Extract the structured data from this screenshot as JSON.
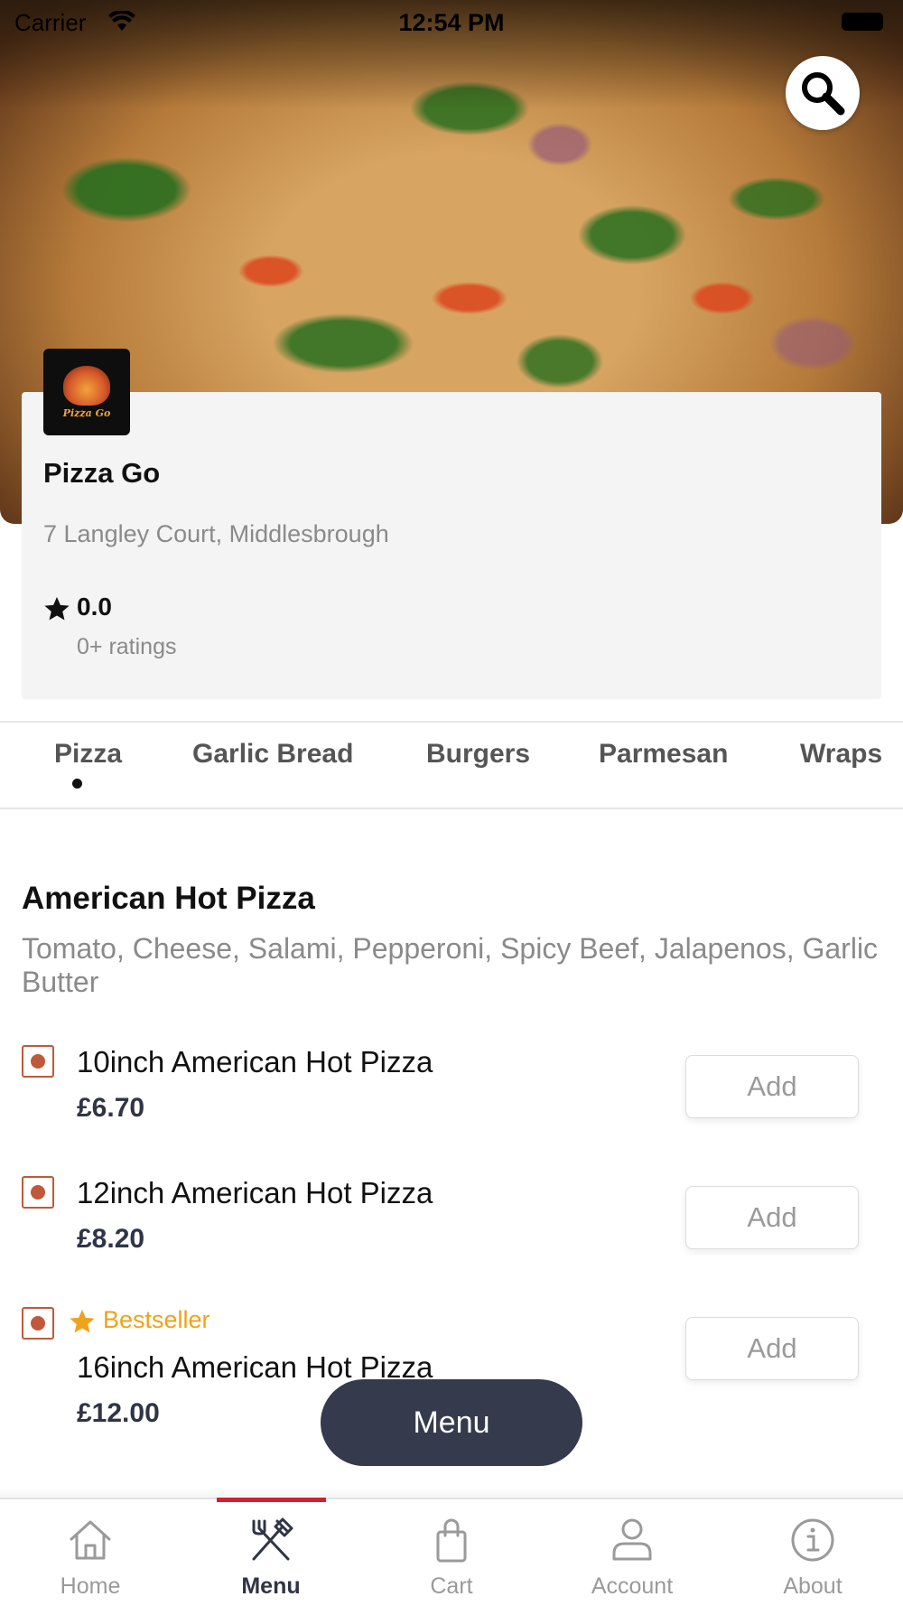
{
  "status_bar": {
    "carrier": "Carrier",
    "time": "12:54 PM"
  },
  "restaurant": {
    "logo_text": "Pizza Go",
    "name": "Pizza Go",
    "address": "7 Langley Court, Middlesbrough",
    "rating": "0.0",
    "ratings_count": "0+ ratings"
  },
  "tabs": [
    {
      "label": "Pizza",
      "active": true
    },
    {
      "label": "Garlic Bread"
    },
    {
      "label": "Burgers"
    },
    {
      "label": "Parmesan"
    },
    {
      "label": "Wraps"
    }
  ],
  "section": {
    "title": "American Hot Pizza",
    "description": "Tomato, Cheese, Salami, Pepperoni, Spicy Beef, Jalapenos, Garlic Butter"
  },
  "items": [
    {
      "name": "10inch American Hot Pizza",
      "price": "£6.70",
      "add_label": "Add"
    },
    {
      "name": "12inch American Hot Pizza",
      "price": "£8.20",
      "add_label": "Add"
    },
    {
      "name": "16inch American Hot Pizza",
      "price": "£12.00",
      "add_label": "Add",
      "badge": "Bestseller"
    }
  ],
  "menu_button": "Menu",
  "bottom_nav": [
    {
      "label": "Home",
      "icon": "home-icon"
    },
    {
      "label": "Menu",
      "icon": "fork-knife-icon",
      "active": true
    },
    {
      "label": "Cart",
      "icon": "shopping-bag-icon"
    },
    {
      "label": "Account",
      "icon": "person-icon"
    },
    {
      "label": "About",
      "icon": "info-icon"
    }
  ],
  "colors": {
    "accent_red": "#d11f36",
    "navy": "#353a4d",
    "bestseller": "#f0a21a",
    "veg_marker": "#c0583a"
  }
}
